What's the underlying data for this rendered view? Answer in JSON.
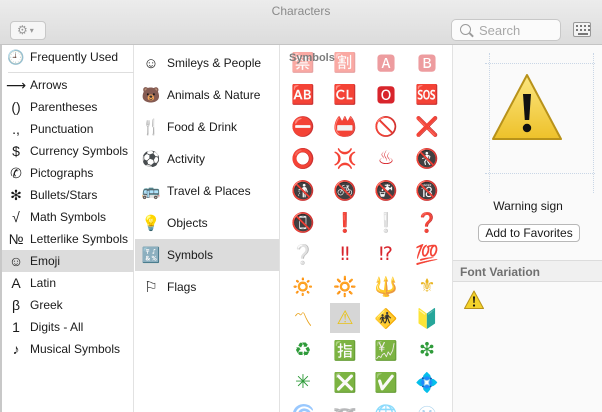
{
  "window": {
    "title": "Characters"
  },
  "toolbar": {
    "search_placeholder": "Search"
  },
  "sidebar": {
    "items": [
      {
        "label": "Frequently Used",
        "icon": "🕘",
        "icon_name": "clock-icon"
      },
      {
        "label": "Arrows",
        "icon": "⟶",
        "icon_name": "arrow-icon"
      },
      {
        "label": "Parentheses",
        "icon": "()",
        "icon_name": "parentheses-icon"
      },
      {
        "label": "Punctuation",
        "icon": ".,",
        "icon_name": "punctuation-icon"
      },
      {
        "label": "Currency Symbols",
        "icon": "$",
        "icon_name": "dollar-icon"
      },
      {
        "label": "Pictographs",
        "icon": "✆",
        "icon_name": "pictograph-icon"
      },
      {
        "label": "Bullets/Stars",
        "icon": "✻",
        "icon_name": "star-bullet-icon"
      },
      {
        "label": "Math Symbols",
        "icon": "√",
        "icon_name": "square-root-icon"
      },
      {
        "label": "Letterlike Symbols",
        "icon": "№",
        "icon_name": "numero-icon"
      },
      {
        "label": "Emoji",
        "icon": "☺",
        "icon_name": "smiley-icon"
      },
      {
        "label": "Latin",
        "icon": "A",
        "icon_name": "latin-letter-icon"
      },
      {
        "label": "Greek",
        "icon": "β",
        "icon_name": "beta-icon"
      },
      {
        "label": "Digits - All",
        "icon": "1",
        "icon_name": "digit-icon"
      },
      {
        "label": "Musical Symbols",
        "icon": "♪",
        "icon_name": "music-note-icon"
      }
    ],
    "selected": "Emoji"
  },
  "subcategories": {
    "items": [
      {
        "label": "Smileys & People",
        "icon": "☺",
        "icon_name": "smiley-icon"
      },
      {
        "label": "Animals & Nature",
        "icon": "🐻",
        "icon_name": "bear-icon"
      },
      {
        "label": "Food & Drink",
        "icon": "🍴",
        "icon_name": "food-icon"
      },
      {
        "label": "Activity",
        "icon": "⚽",
        "icon_name": "soccer-ball-icon"
      },
      {
        "label": "Travel & Places",
        "icon": "🚌",
        "icon_name": "bus-icon"
      },
      {
        "label": "Objects",
        "icon": "💡",
        "icon_name": "lightbulb-icon"
      },
      {
        "label": "Symbols",
        "icon": "🔣",
        "icon_name": "symbols-icon"
      },
      {
        "label": "Flags",
        "icon": "⚐",
        "icon_name": "flag-icon"
      }
    ],
    "selected": "Symbols"
  },
  "grid": {
    "header": "Symbols",
    "rows": [
      [
        {
          "c": "🈲",
          "color": "#d8252c",
          "faded": true
        },
        {
          "c": "🈹",
          "color": "#d8252c",
          "faded": true
        },
        {
          "c": "🅰",
          "color": "#d8252c",
          "faded": true
        },
        {
          "c": "🅱",
          "color": "#d8252c",
          "faded": true
        }
      ],
      [
        {
          "c": "🆎",
          "color": "#d8252c"
        },
        {
          "c": "🆑",
          "color": "#d8252c"
        },
        {
          "c": "🅾",
          "color": "#d8252c"
        },
        {
          "c": "🆘",
          "color": "#d8252c"
        }
      ],
      [
        {
          "c": "⛔",
          "color": "#d8252c"
        },
        {
          "c": "📛",
          "color": "#d8252c"
        },
        {
          "c": "🚫",
          "color": "#d8252c"
        },
        {
          "c": "❌",
          "color": "#d8252c"
        }
      ],
      [
        {
          "c": "⭕",
          "color": "#d8252c"
        },
        {
          "c": "💢",
          "color": "#d8252c"
        },
        {
          "c": "♨",
          "color": "#d8252c"
        },
        {
          "c": "🚷",
          "color": "#d8252c"
        }
      ],
      [
        {
          "c": "🚯",
          "color": "#d8252c"
        },
        {
          "c": "🚳",
          "color": "#d8252c"
        },
        {
          "c": "🚱",
          "color": "#d8252c"
        },
        {
          "c": "🔞",
          "color": "#d8252c"
        }
      ],
      [
        {
          "c": "📵",
          "color": "#d8252c"
        },
        {
          "c": "❗",
          "color": "#d8252c"
        },
        {
          "c": "❕",
          "color": "#c8c8c8"
        },
        {
          "c": "❓",
          "color": "#d8252c"
        }
      ],
      [
        {
          "c": "❔",
          "color": "#c8c8c8"
        },
        {
          "c": "‼",
          "color": "#d8252c"
        },
        {
          "c": "⁉",
          "color": "#d8252c"
        },
        {
          "c": "💯",
          "color": "#d8252c"
        }
      ],
      [
        {
          "c": "🔅",
          "color": "#e9b31b"
        },
        {
          "c": "🔆",
          "color": "#e9b31b"
        },
        {
          "c": "🔱",
          "color": "#e9b31b"
        },
        {
          "c": "⚜",
          "color": "#e9b31b"
        }
      ],
      [
        {
          "c": "〽",
          "color": "#e9a21b"
        },
        {
          "c": "⚠",
          "color": "#e8c21c",
          "selected": true
        },
        {
          "c": "🚸",
          "color": "#e8c21c"
        },
        {
          "c": "🔰",
          "color": "#3a9a3a"
        }
      ],
      [
        {
          "c": "♻",
          "color": "#2f9b3a"
        },
        {
          "c": "🈯",
          "color": "#2f9b3a"
        },
        {
          "c": "💹",
          "color": "#2f9b3a"
        },
        {
          "c": "❇",
          "color": "#2f9b3a"
        }
      ],
      [
        {
          "c": "✳",
          "color": "#2f9b3a"
        },
        {
          "c": "❎",
          "color": "#2f9b3a"
        },
        {
          "c": "✅",
          "color": "#2f9b3a"
        },
        {
          "c": "💠",
          "color": "#4aa0d8"
        }
      ],
      [
        {
          "c": "🌀",
          "color": "#4aa0d8",
          "faded": true
        },
        {
          "c": "➿",
          "color": "#4aa0d8",
          "faded": true
        },
        {
          "c": "🌐",
          "color": "#4aa0d8",
          "faded": true
        },
        {
          "c": "Ⓜ",
          "color": "#4aa0d8",
          "faded": true
        }
      ]
    ]
  },
  "detail": {
    "char_name": "Warning sign",
    "add_favorites_label": "Add to Favorites",
    "font_variation_label": "Font Variation"
  },
  "colors": {
    "selection": "#dcdcdc",
    "warning_yellow": "#f3d22b",
    "warning_outline": "#b8921a",
    "emoji_red": "#d8252c"
  }
}
